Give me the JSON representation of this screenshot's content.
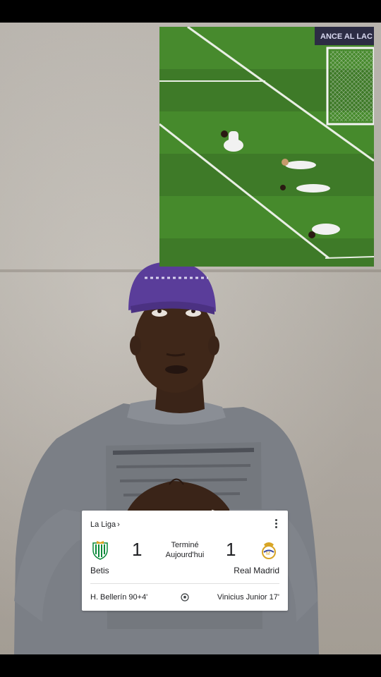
{
  "video": {
    "inset_banner": "ANCE AL LAC"
  },
  "score_card": {
    "league": "La Liga",
    "league_chevron": "›",
    "status_line1": "Terminé",
    "status_line2": "Aujourd'hui",
    "home": {
      "name": "Betis",
      "score": "1",
      "crest_icon": "real-betis-crest-icon",
      "scorer": "H. Bellerín 90+4'"
    },
    "away": {
      "name": "Real Madrid",
      "score": "1",
      "crest_icon": "real-madrid-crest-icon",
      "scorer": "Vinicius Junior 17'"
    },
    "goal_icon": "soccer-ball-icon",
    "menu_icon": "more-vert-icon"
  },
  "colors": {
    "betis_green": "#0a8a3a",
    "madrid_gold": "#d8a526",
    "beanie": "#5a3d9a",
    "hoodie": "#7b7f86",
    "pitch": "#3e7a28"
  }
}
